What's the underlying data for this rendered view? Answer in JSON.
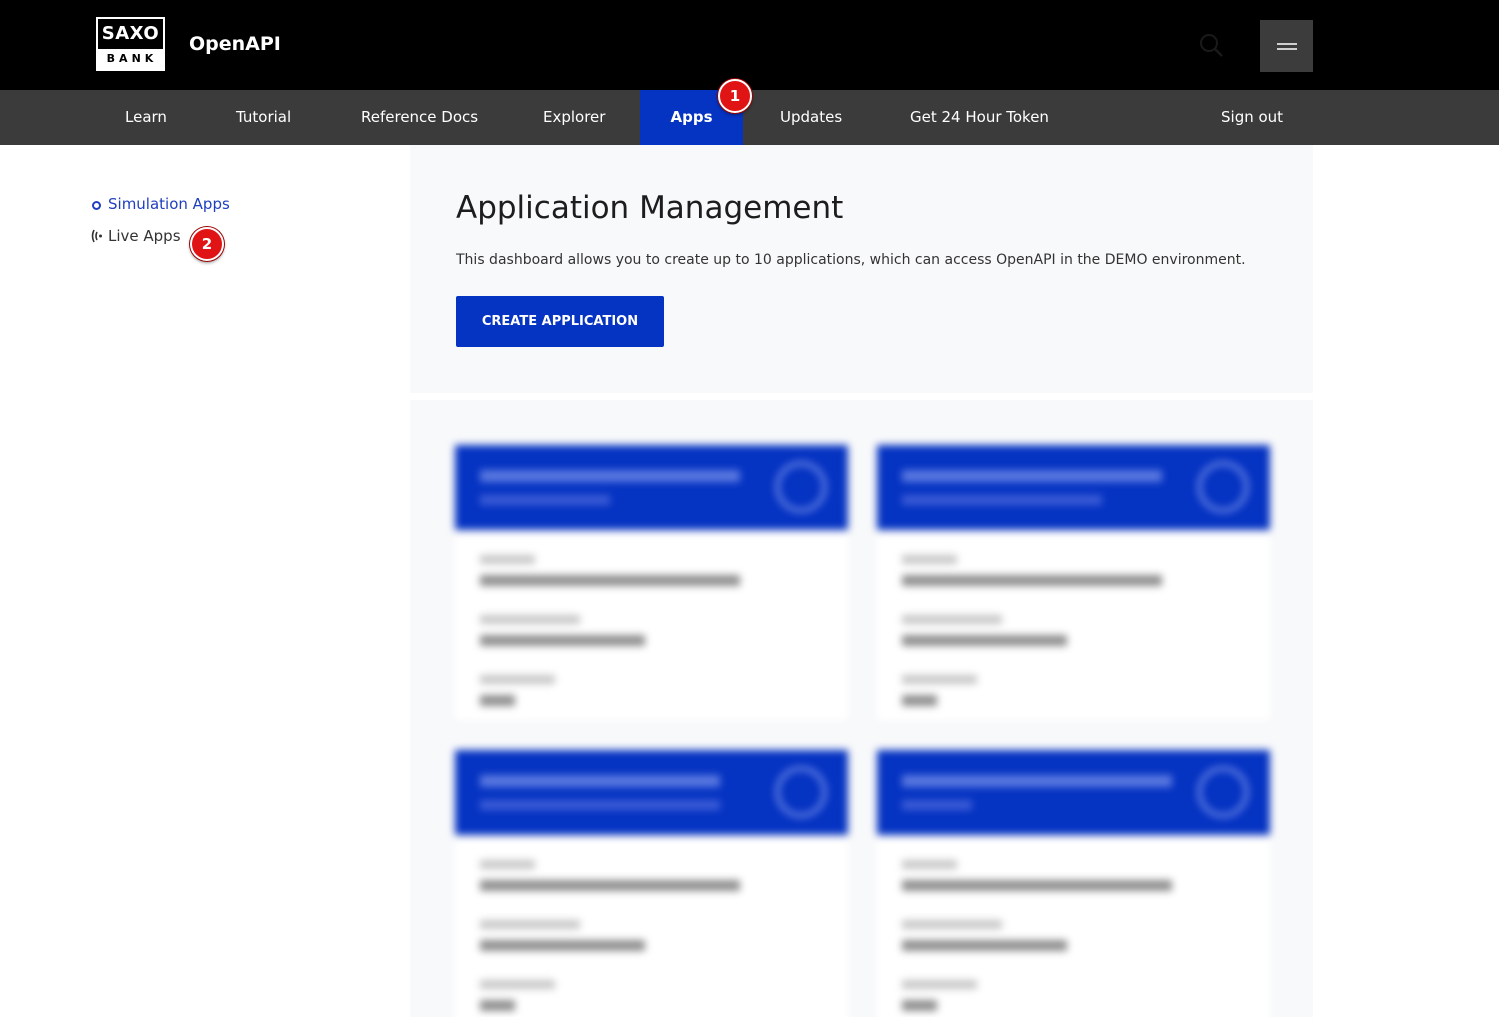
{
  "header": {
    "logo_top": "SAXO",
    "logo_bottom": "BANK",
    "title": "OpenAPI",
    "search_icon": "search-icon",
    "menu_icon": "hamburger-icon"
  },
  "nav": {
    "items": [
      {
        "label": "Learn"
      },
      {
        "label": "Tutorial"
      },
      {
        "label": "Reference Docs"
      },
      {
        "label": "Explorer"
      },
      {
        "label": "Apps",
        "active": true
      },
      {
        "label": "Updates"
      },
      {
        "label": "Get 24 Hour Token"
      }
    ],
    "sign_out": "Sign out"
  },
  "annotations": [
    "1",
    "2"
  ],
  "sidebar": {
    "items": [
      {
        "label": "Simulation Apps",
        "icon": "circle-icon",
        "color": "#1f3fbf"
      },
      {
        "label": "Live Apps",
        "icon": "broadcast-icon",
        "color": "#333333"
      }
    ]
  },
  "main": {
    "title": "Application Management",
    "description": "This dashboard allows you to create up to 10 applications, which can access OpenAPI in the DEMO environment.",
    "create_button": "CREATE APPLICATION"
  },
  "colors": {
    "accent": "#0533c2",
    "topbar": "#000000",
    "navbar": "#3b3b3b",
    "badge": "#e01414"
  }
}
